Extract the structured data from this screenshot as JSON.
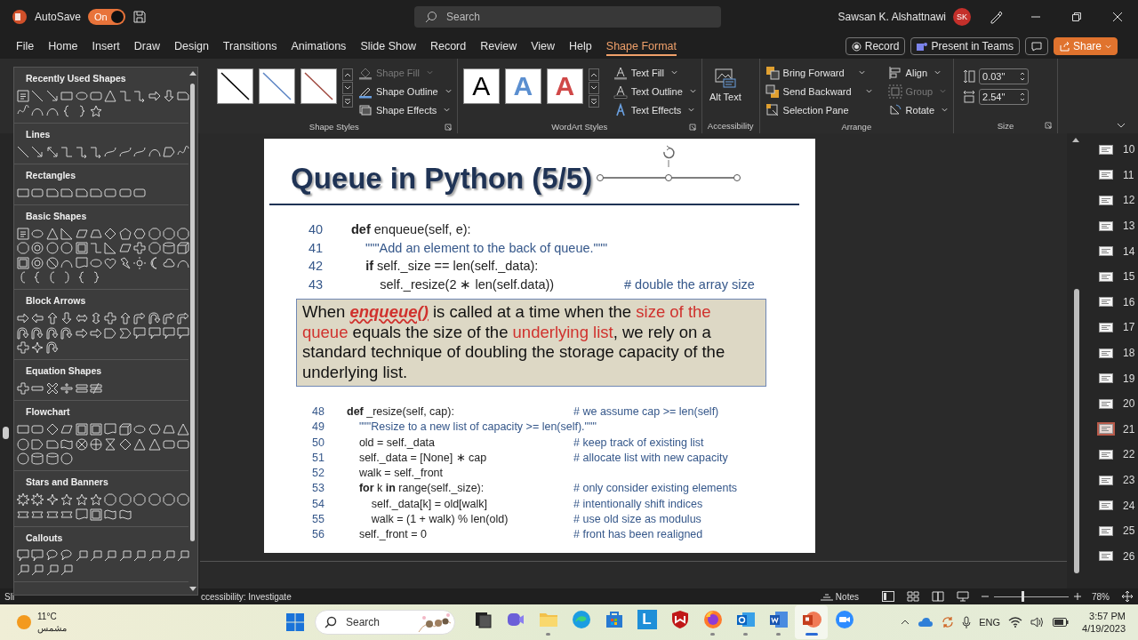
{
  "title_bar": {
    "autosave_label": "AutoSave",
    "autosave_toggle": {
      "label": "On",
      "on": true
    },
    "search": {
      "placeholder": "Search"
    },
    "user_name": "Sawsan K. Alshattnawi",
    "avatar_initials": "SK"
  },
  "ribbon_tabs": [
    {
      "label": "File",
      "selected": false
    },
    {
      "label": "Home",
      "selected": false
    },
    {
      "label": "Insert",
      "selected": false
    },
    {
      "label": "Draw",
      "selected": false
    },
    {
      "label": "Design",
      "selected": false
    },
    {
      "label": "Transitions",
      "selected": false
    },
    {
      "label": "Animations",
      "selected": false
    },
    {
      "label": "Slide Show",
      "selected": false
    },
    {
      "label": "Record",
      "selected": false
    },
    {
      "label": "Review",
      "selected": false
    },
    {
      "label": "View",
      "selected": false
    },
    {
      "label": "Help",
      "selected": false
    },
    {
      "label": "Shape Format",
      "selected": true
    }
  ],
  "ribbon_actions": [
    {
      "kind": "record",
      "label": "Record"
    },
    {
      "kind": "teams",
      "label": "Present in Teams"
    },
    {
      "kind": "comments"
    },
    {
      "kind": "share",
      "label": "Share"
    }
  ],
  "ribbon_groups": [
    {
      "kind": "shape-styles",
      "label": "Shape Styles",
      "swatches": [
        {
          "color": "#000000"
        },
        {
          "color": "#5b84c4"
        },
        {
          "color": "#a04a40"
        }
      ],
      "commands": [
        {
          "label": "Shape Fill",
          "kind": "menu",
          "disabled": true
        },
        {
          "label": "Shape Outline",
          "kind": "menu",
          "disabled": false
        },
        {
          "label": "Shape Effects",
          "kind": "menu",
          "disabled": false
        }
      ]
    },
    {
      "kind": "wordart",
      "label": "WordArt Styles",
      "swatches": [
        {
          "glyph": "A",
          "kind": "fill",
          "color": "#000000"
        },
        {
          "glyph": "A",
          "kind": "outline",
          "color": "#5b8fd0"
        },
        {
          "glyph": "A",
          "kind": "outline",
          "color": "#d04848"
        }
      ],
      "commands": [
        {
          "label": "Text Fill",
          "kind": "menu",
          "disabled": false
        },
        {
          "label": "Text Outline",
          "kind": "menu",
          "disabled": false
        },
        {
          "label": "Text Effects",
          "kind": "menu",
          "disabled": false
        }
      ]
    },
    {
      "kind": "accessibility",
      "label": "Accessibility",
      "commands": [
        {
          "label": "Alt Text",
          "kind": "large",
          "disabled": false
        }
      ]
    },
    {
      "kind": "arrange",
      "label": "Arrange",
      "commands": [
        {
          "label": "Bring Forward",
          "kind": "split",
          "disabled": false
        },
        {
          "label": "Send Backward",
          "kind": "split",
          "disabled": false
        },
        {
          "label": "Selection Pane",
          "kind": "button",
          "disabled": false
        },
        {
          "label": "Align",
          "kind": "menu",
          "disabled": false
        },
        {
          "label": "Group",
          "kind": "menu",
          "disabled": true
        },
        {
          "label": "Rotate",
          "kind": "menu",
          "disabled": false
        }
      ]
    },
    {
      "kind": "size",
      "label": "Size",
      "fields": [
        {
          "value": "0.03\""
        },
        {
          "value": "2.54\""
        }
      ]
    }
  ],
  "shapes_gallery": {
    "sections": [
      {
        "title": "Recently Used Shapes"
      },
      {
        "title": "Lines"
      },
      {
        "title": "Rectangles"
      },
      {
        "title": "Basic Shapes"
      },
      {
        "title": "Block Arrows"
      },
      {
        "title": "Equation Shapes"
      },
      {
        "title": "Flowchart"
      },
      {
        "title": "Stars and Banners"
      },
      {
        "title": "Callouts"
      }
    ]
  },
  "slide": {
    "title": "Queue in Python (5/5)",
    "code_top": [
      {
        "number": "40",
        "kind": "code",
        "code": "**def** enqueue(self, e):"
      },
      {
        "number": "41",
        "kind": "docstring",
        "code": "    \"\"\"Add an element to the back of queue.\"\"\""
      },
      {
        "number": "42",
        "kind": "code",
        "code": "    **if** self._size == len(self._data):"
      },
      {
        "number": "43",
        "kind": "code",
        "code": "        self._resize(2 ∗ len(self.data))",
        "comment": "# double the array size"
      }
    ],
    "callout": {
      "segments": [
        {
          "text": "When ",
          "kind": "plain"
        },
        {
          "text": "enqueue()",
          "kind": "keyword"
        },
        {
          "text": " is called at a time when the ",
          "kind": "plain"
        },
        {
          "text": "size of the queue",
          "kind": "highlight"
        },
        {
          "text": " equals the size of the ",
          "kind": "plain"
        },
        {
          "text": "underlying list",
          "kind": "highlight"
        },
        {
          "text": ", we rely on a standard technique of doubling the storage capacity of the underlying list.",
          "kind": "plain"
        }
      ]
    },
    "code_bottom": [
      {
        "number": "48",
        "kind": "code",
        "code": "**def** _resize(self, cap):",
        "comment": "# we assume cap >= len(self)"
      },
      {
        "number": "49",
        "kind": "docstring",
        "code": "    \"\"\"Resize to a new list of capacity >= len(self).\"\"\""
      },
      {
        "number": "50",
        "kind": "code",
        "code": "    old = self._data",
        "comment": "# keep track of existing list"
      },
      {
        "number": "51",
        "kind": "code",
        "code": "    self._data = [None] ∗ cap",
        "comment": "# allocate list with new capacity"
      },
      {
        "number": "52",
        "kind": "code",
        "code": "    walk = self._front"
      },
      {
        "number": "53",
        "kind": "code",
        "code": "    **for** k **in** range(self._size):",
        "comment": "# only consider existing elements"
      },
      {
        "number": "54",
        "kind": "code",
        "code": "        self._data[k] = old[walk]",
        "comment": "# intentionally shift indices"
      },
      {
        "number": "55",
        "kind": "code",
        "code": "        walk = (1 + walk) % len(old)",
        "comment": "# use old size as modulus"
      },
      {
        "number": "56",
        "kind": "code",
        "code": "    self._front = 0",
        "comment": "# front has been realigned"
      }
    ]
  },
  "slide_thumbnails": [
    {
      "number": "10",
      "selected": false
    },
    {
      "number": "11",
      "selected": false
    },
    {
      "number": "12",
      "selected": false
    },
    {
      "number": "13",
      "selected": false
    },
    {
      "number": "14",
      "selected": false
    },
    {
      "number": "15",
      "selected": false
    },
    {
      "number": "16",
      "selected": false
    },
    {
      "number": "17",
      "selected": false
    },
    {
      "number": "18",
      "selected": false
    },
    {
      "number": "19",
      "selected": false
    },
    {
      "number": "20",
      "selected": false
    },
    {
      "number": "21",
      "selected": true
    },
    {
      "number": "22",
      "selected": false
    },
    {
      "number": "23",
      "selected": false
    },
    {
      "number": "24",
      "selected": false
    },
    {
      "number": "25",
      "selected": false
    },
    {
      "number": "26",
      "selected": false
    }
  ],
  "status_bar": {
    "slide_info": "Sli",
    "accessibility": "ccessibility: Investigate",
    "notes": "Notes",
    "zoom": {
      "level": 0.38
    },
    "zoom_percent": "78%"
  },
  "taskbar": {
    "weather": {
      "temperature": "11°C",
      "condition": "مشمس"
    },
    "search": {
      "placeholder": "Search"
    },
    "apps": [
      {
        "kind": "task-view",
        "running": false,
        "selected": false
      },
      {
        "kind": "chat",
        "running": false,
        "selected": false
      },
      {
        "kind": "folder",
        "running": true,
        "selected": false
      },
      {
        "kind": "edge",
        "running": false,
        "selected": false
      },
      {
        "kind": "store",
        "running": false,
        "selected": false
      },
      {
        "kind": "tile",
        "glyph": "L",
        "running": false,
        "selected": false
      },
      {
        "kind": "shield",
        "running": false,
        "selected": false
      },
      {
        "kind": "firefox",
        "running": true,
        "selected": false
      },
      {
        "kind": "mail",
        "running": true,
        "selected": false
      },
      {
        "kind": "word",
        "running": true,
        "selected": false
      },
      {
        "kind": "slides",
        "running": true,
        "selected": true
      },
      {
        "kind": "video",
        "running": false,
        "selected": false
      }
    ],
    "tray": {
      "language": "ENG",
      "time": "3:57 PM",
      "date": "4/19/2023"
    }
  }
}
